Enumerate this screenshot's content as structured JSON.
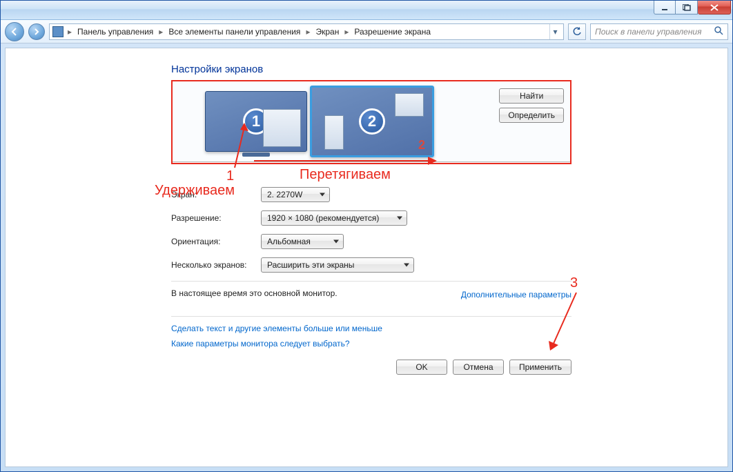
{
  "breadcrumb": {
    "items": [
      "Панель управления",
      "Все элементы панели управления",
      "Экран",
      "Разрешение экрана"
    ]
  },
  "search": {
    "placeholder": "Поиск в панели управления"
  },
  "page": {
    "title": "Настройки экранов"
  },
  "monitors": {
    "m1_number": "1",
    "m2_number": "2",
    "m2_overlay": "2",
    "find_label": "Найти",
    "detect_label": "Определить"
  },
  "form": {
    "screen_label": "Экран:",
    "screen_value": "2. 2270W",
    "resolution_label": "Разрешение:",
    "resolution_value": "1920 × 1080 (рекомендуется)",
    "orientation_label": "Ориентация:",
    "orientation_value": "Альбомная",
    "multi_label": "Несколько экранов:",
    "multi_value": "Расширить эти экраны"
  },
  "status": {
    "primary_text": "В настоящее время это основной монитор.",
    "extra_link": "Дополнительные параметры"
  },
  "links": {
    "text_size": "Сделать текст и другие элементы больше или меньше",
    "which_monitor": "Какие параметры монитора следует выбрать?"
  },
  "buttons": {
    "ok": "OK",
    "cancel": "Отмена",
    "apply": "Применить"
  },
  "annotations": {
    "n1": "1",
    "hold": "Удерживаем",
    "drag": "Перетягиваем",
    "n3": "3"
  }
}
